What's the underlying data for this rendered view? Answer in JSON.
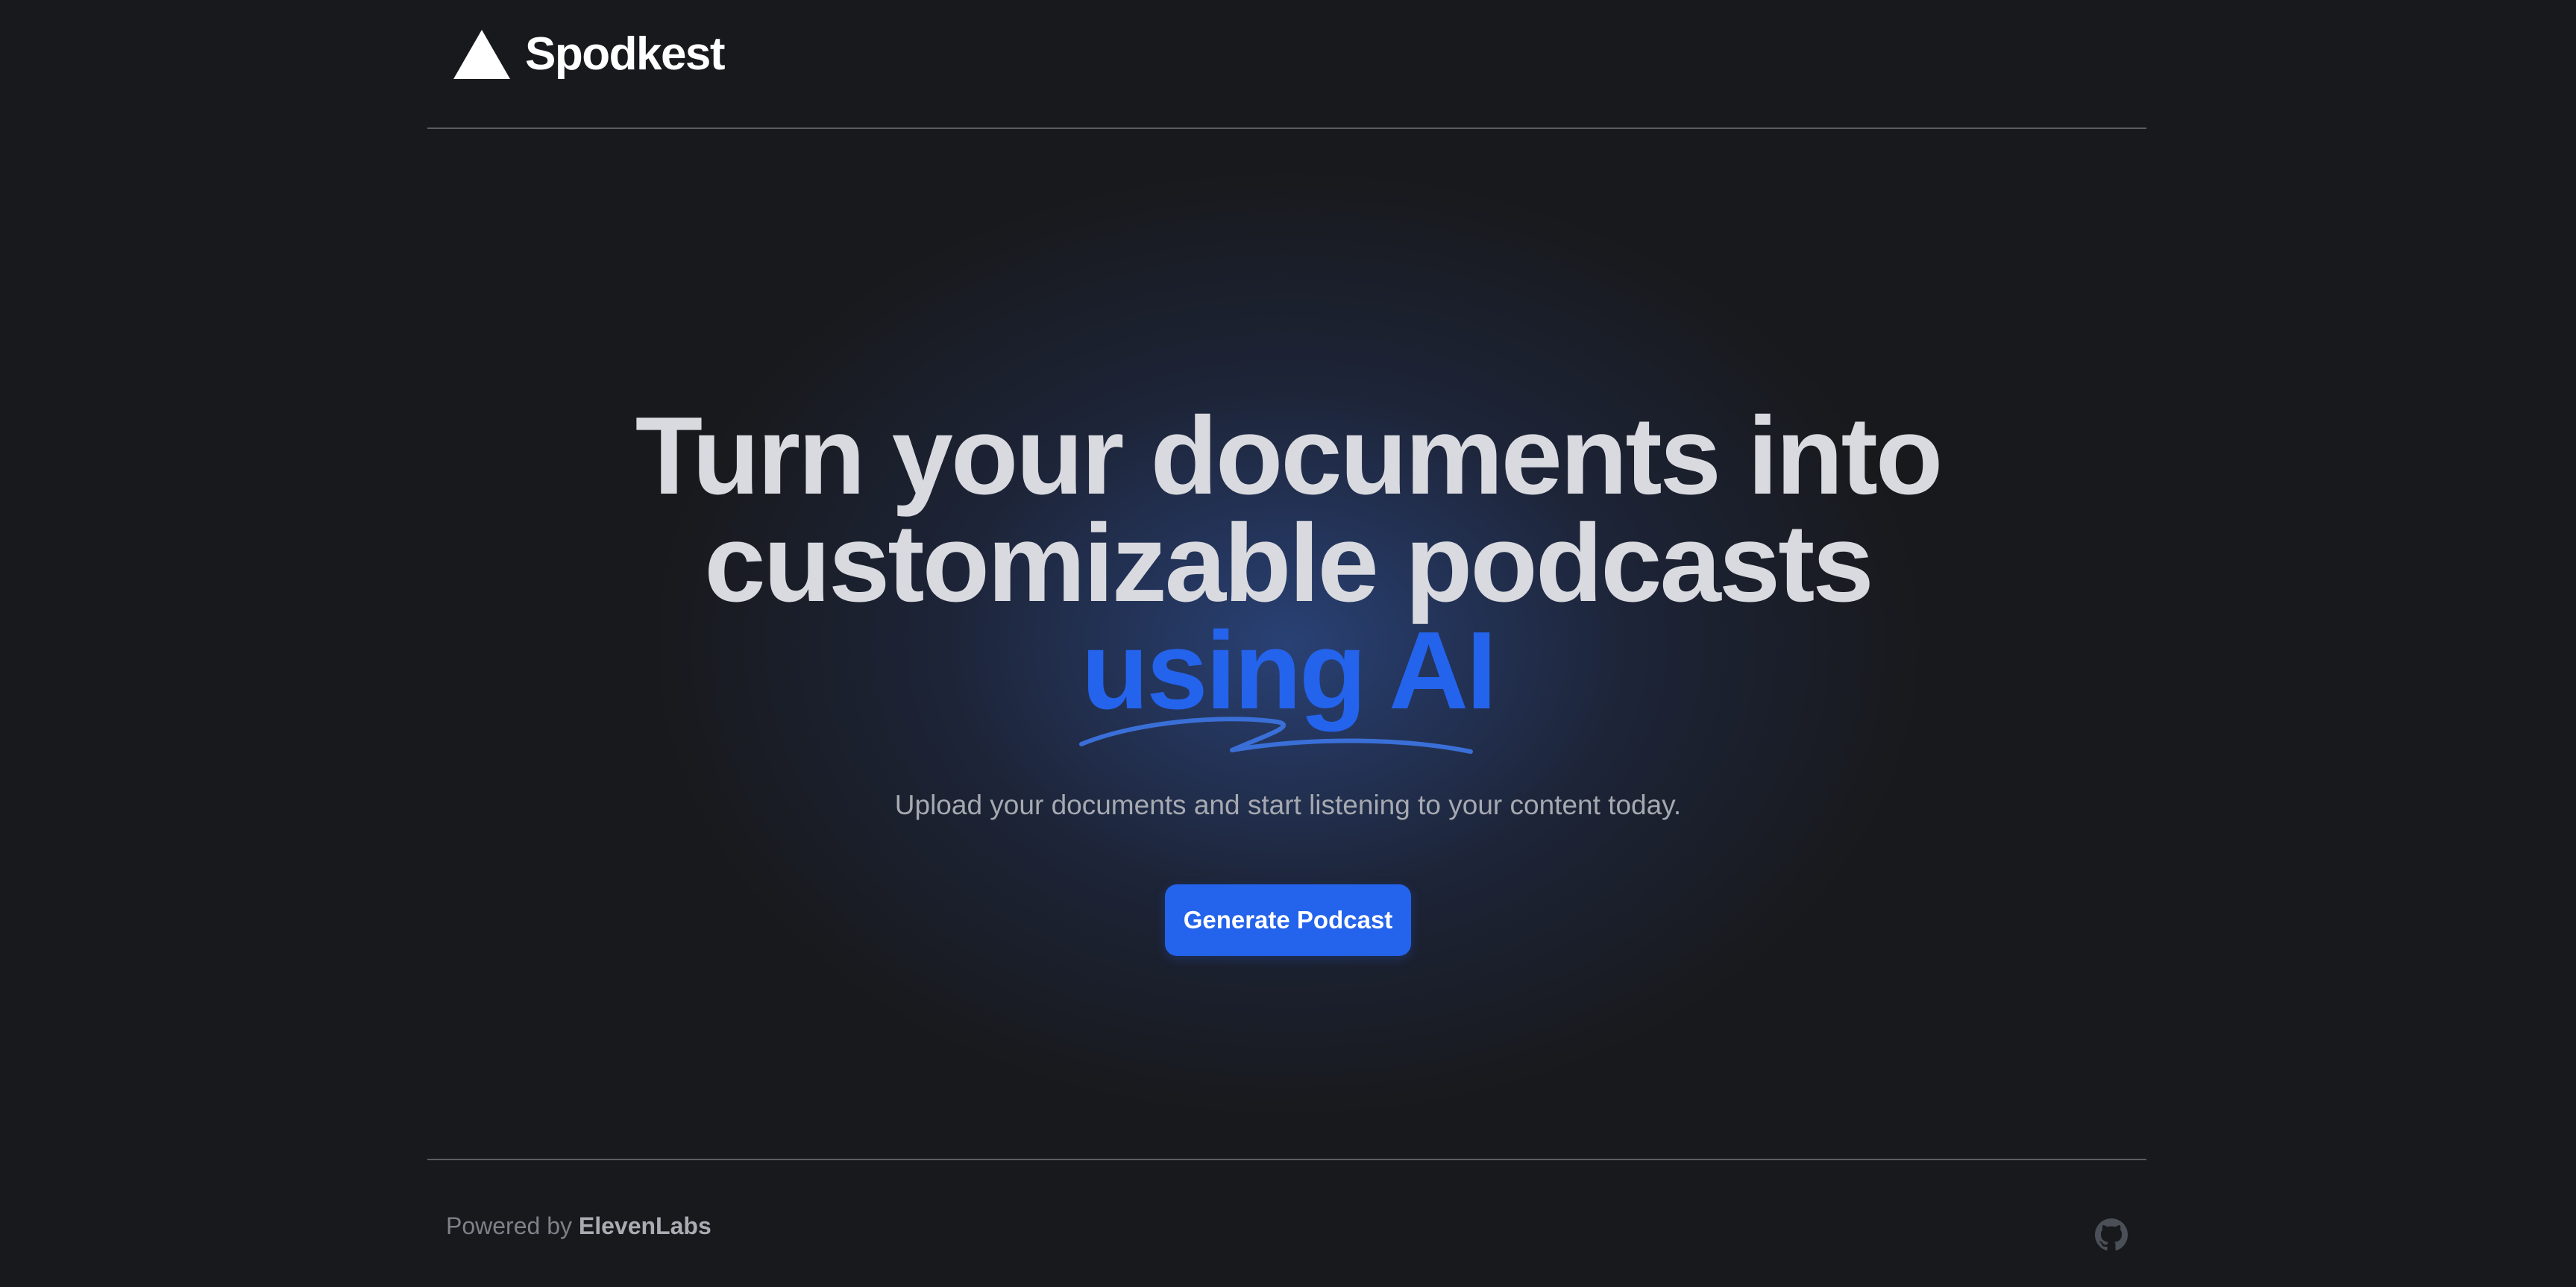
{
  "header": {
    "logo_text": "Spodkest",
    "logo_icon": "triangle-logo-icon"
  },
  "hero": {
    "title_line1": "Turn your documents into",
    "title_line2": "customizable podcasts",
    "title_accent": "using AI",
    "subtitle": "Upload your documents and start listening to your content today.",
    "cta_label": "Generate Podcast"
  },
  "footer": {
    "powered_prefix": "Powered by",
    "powered_brand": "ElevenLabs",
    "github_icon": "github-icon"
  },
  "colors": {
    "background": "#18191c",
    "accent": "#2463eb",
    "title_text": "#d9dadf",
    "subtitle_text": "#a6a9b0",
    "divider": "#5a5d63"
  }
}
